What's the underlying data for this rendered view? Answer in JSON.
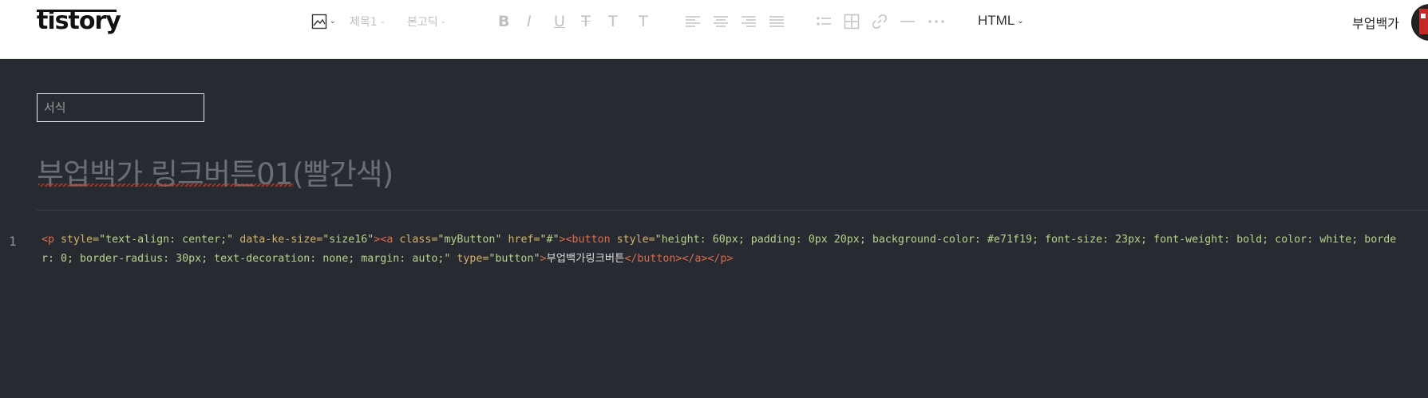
{
  "app": {
    "logo": "tistory"
  },
  "toolbar": {
    "heading_label": "제목1",
    "font_label": "본고딕",
    "mode_label": "HTML",
    "user_name": "부업백가"
  },
  "editor": {
    "category_placeholder": "서식",
    "title": "부업백가 링크버튼01(빨간색)",
    "line_number": "1",
    "code": {
      "p_open": "<p",
      "p_attr1": " style=",
      "p_val1": "\"text-align: center;\"",
      "p_attr2": " data-ke-size=",
      "p_val2": "\"size16\"",
      "p_close": ">",
      "a_open": "<a",
      "a_attr1": " class=",
      "a_val1": "\"myButton\"",
      "a_attr2": " href=",
      "a_val2": "\"#\"",
      "a_close": ">",
      "btn_open": "<button",
      "btn_attr1": " style=",
      "btn_val1": "\"height: 60px; padding: 0px 20px; background-color: #e71f19; font-size: 23px; font-weight: bold; color: white; border: 0; border-radius: 30px; text-decoration: none; margin: auto;\"",
      "btn_attr2": " type=",
      "btn_val2": "\"button\"",
      "btn_close": ">",
      "inner_text": "부업백가링크버튼",
      "end_tags": "</button></a></p>"
    }
  },
  "colors": {
    "editor_bg": "#272a31",
    "tag": "#e06c4b",
    "string": "#b7d48c"
  }
}
